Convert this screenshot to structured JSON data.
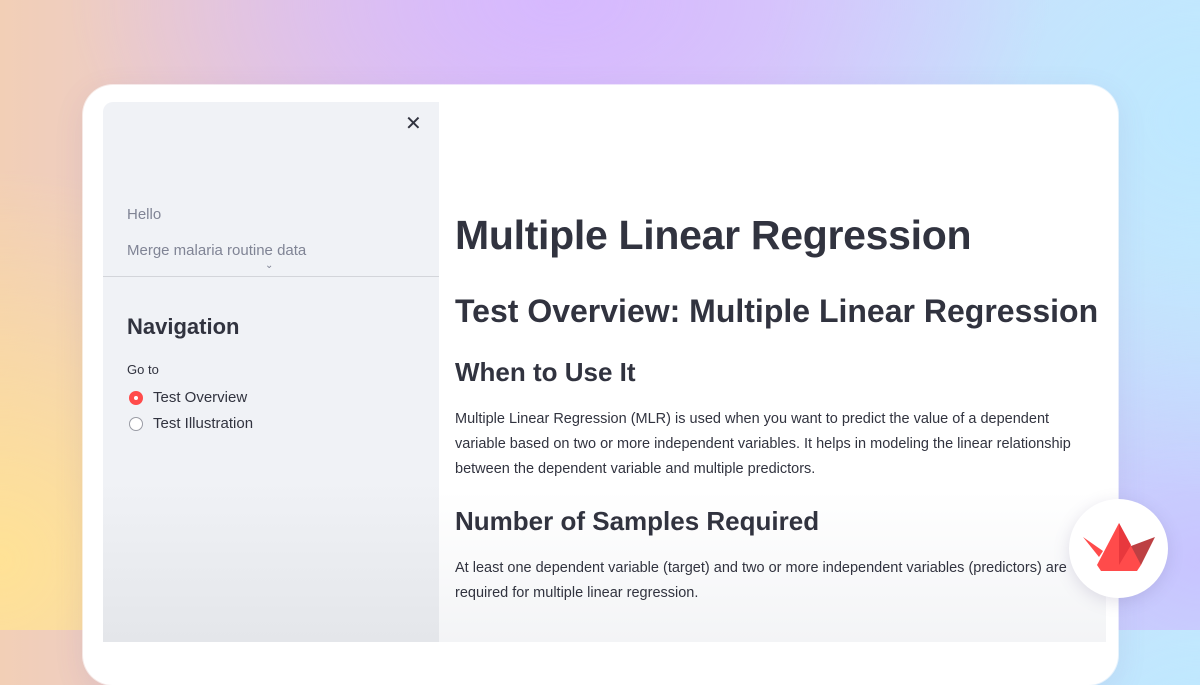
{
  "sidebar": {
    "pages": [
      "Hello",
      "Merge malaria routine data"
    ],
    "nav_title": "Navigation",
    "radio_label": "Go to",
    "options": [
      {
        "label": "Test Overview",
        "selected": true
      },
      {
        "label": "Test Illustration",
        "selected": false
      }
    ]
  },
  "main": {
    "title": "Multiple Linear Regression",
    "subtitle": "Test Overview: Multiple Linear Regression",
    "section1_heading": "When to Use It",
    "section1_text": "Multiple Linear Regression (MLR) is used when you want to predict the value of a dependent variable based on two or more independent variables. It helps in modeling the linear relationship between the dependent variable and multiple predictors.",
    "section2_heading": "Number of Samples Required",
    "section2_text": "At least one dependent variable (target) and two or more independent variables (predictors) are required for multiple linear regression."
  },
  "icons": {
    "close": "close-icon",
    "expand": "chevron-down-icon",
    "logo": "streamlit-logo"
  },
  "colors": {
    "accent": "#ff4b4b",
    "sidebar_bg": "#f0f2f6",
    "text": "#31333f"
  }
}
